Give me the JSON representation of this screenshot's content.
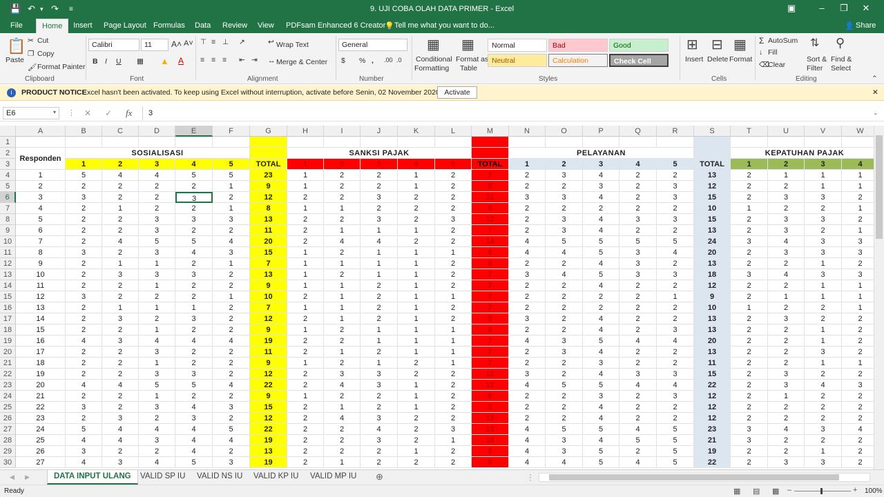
{
  "window": {
    "title": "9. UJI COBA OLAH DATA PRIMER - Excel",
    "share": "Share"
  },
  "tabs": [
    "File",
    "Home",
    "Insert",
    "Page Layout",
    "Formulas",
    "Data",
    "Review",
    "View",
    "PDFsam Enhanced 6 Creator",
    "Tell me what you want to do..."
  ],
  "ribbon": {
    "clipboard": {
      "paste": "Paste",
      "cut": "Cut",
      "copy": "Copy",
      "format_painter": "Format Painter",
      "group": "Clipboard"
    },
    "font": {
      "name": "Calibri",
      "size": "11",
      "group": "Font"
    },
    "alignment": {
      "wrap": "Wrap Text",
      "merge": "Merge & Center",
      "group": "Alignment"
    },
    "number": {
      "format": "General",
      "group": "Number"
    },
    "styles": {
      "conditional": "Conditional",
      "conditional2": "Formatting",
      "format_as": "Format as",
      "format_as2": "Table",
      "normal": "Normal",
      "bad": "Bad",
      "good": "Good",
      "neutral": "Neutral",
      "calculation": "Calculation",
      "check": "Check Cell",
      "group": "Styles"
    },
    "cells": {
      "insert": "Insert",
      "delete": "Delete",
      "format": "Format",
      "group": "Cells"
    },
    "editing": {
      "autosum": "AutoSum",
      "fill": "Fill",
      "clear": "Clear",
      "sort": "Sort &",
      "sort2": "Filter",
      "find": "Find &",
      "find2": "Select",
      "group": "Editing"
    }
  },
  "notice": {
    "label": "PRODUCT NOTICE",
    "text": "Excel hasn't been activated. To keep using Excel without interruption, activate before Senin, 02 November 2020.",
    "button": "Activate"
  },
  "formula_bar": {
    "name_box": "E6",
    "value": "3"
  },
  "grid": {
    "columns": [
      "A",
      "B",
      "C",
      "D",
      "E",
      "F",
      "G",
      "H",
      "I",
      "J",
      "K",
      "L",
      "M",
      "N",
      "O",
      "P",
      "Q",
      "R",
      "S",
      "T",
      "U",
      "V",
      "W"
    ],
    "row_numbers": [
      "1",
      "2",
      "3",
      "4",
      "5",
      "6",
      "7",
      "8",
      "9",
      "10",
      "11",
      "12",
      "13",
      "14",
      "15",
      "16",
      "17",
      "18",
      "19",
      "20",
      "21",
      "22",
      "23",
      "24",
      "25",
      "26",
      "27",
      "28",
      "29",
      "30"
    ],
    "responden_label": "Responden",
    "groups": [
      "SOSIALISASI",
      "SANKSI PAJAK",
      "PELAYANAN",
      "KEPATUHAN PAJAK"
    ],
    "subheaders": [
      "1",
      "2",
      "3",
      "4",
      "5",
      "TOTAL",
      "1",
      "2",
      "3",
      "4",
      "5",
      "TOTAL",
      "1",
      "2",
      "3",
      "4",
      "5",
      "TOTAL",
      "1",
      "2",
      "3",
      "4"
    ],
    "rows": [
      [
        "1",
        "5",
        "4",
        "4",
        "5",
        "5",
        "23",
        "1",
        "2",
        "2",
        "1",
        "2",
        "7",
        "2",
        "3",
        "4",
        "2",
        "2",
        "13",
        "2",
        "1",
        "1",
        "1"
      ],
      [
        "2",
        "2",
        "2",
        "2",
        "2",
        "1",
        "9",
        "1",
        "2",
        "2",
        "1",
        "2",
        "8",
        "2",
        "2",
        "3",
        "2",
        "3",
        "12",
        "2",
        "2",
        "1",
        "1"
      ],
      [
        "3",
        "3",
        "2",
        "2",
        "3",
        "2",
        "12",
        "2",
        "2",
        "3",
        "2",
        "2",
        "11",
        "3",
        "3",
        "4",
        "2",
        "3",
        "15",
        "2",
        "3",
        "3",
        "2"
      ],
      [
        "4",
        "2",
        "1",
        "2",
        "2",
        "1",
        "8",
        "1",
        "1",
        "2",
        "2",
        "2",
        "8",
        "2",
        "2",
        "2",
        "2",
        "2",
        "10",
        "1",
        "2",
        "2",
        "1"
      ],
      [
        "5",
        "2",
        "2",
        "3",
        "3",
        "3",
        "13",
        "2",
        "2",
        "3",
        "2",
        "3",
        "12",
        "2",
        "3",
        "4",
        "3",
        "3",
        "15",
        "2",
        "3",
        "3",
        "2"
      ],
      [
        "6",
        "2",
        "2",
        "3",
        "2",
        "2",
        "11",
        "2",
        "1",
        "1",
        "1",
        "2",
        "7",
        "2",
        "3",
        "4",
        "2",
        "2",
        "13",
        "2",
        "3",
        "2",
        "1"
      ],
      [
        "7",
        "2",
        "4",
        "5",
        "5",
        "4",
        "20",
        "2",
        "4",
        "4",
        "2",
        "2",
        "14",
        "4",
        "5",
        "5",
        "5",
        "5",
        "24",
        "3",
        "4",
        "3",
        "3"
      ],
      [
        "8",
        "3",
        "2",
        "3",
        "4",
        "3",
        "15",
        "1",
        "2",
        "1",
        "1",
        "1",
        "6",
        "4",
        "4",
        "5",
        "3",
        "4",
        "20",
        "2",
        "3",
        "3",
        "3"
      ],
      [
        "9",
        "2",
        "1",
        "1",
        "2",
        "1",
        "7",
        "1",
        "1",
        "1",
        "1",
        "2",
        "6",
        "2",
        "2",
        "4",
        "3",
        "2",
        "13",
        "2",
        "2",
        "1",
        "2"
      ],
      [
        "10",
        "2",
        "3",
        "3",
        "3",
        "2",
        "13",
        "1",
        "2",
        "1",
        "1",
        "2",
        "7",
        "3",
        "4",
        "5",
        "3",
        "3",
        "18",
        "3",
        "4",
        "3",
        "3"
      ],
      [
        "11",
        "2",
        "2",
        "1",
        "2",
        "2",
        "9",
        "1",
        "1",
        "2",
        "1",
        "2",
        "7",
        "2",
        "2",
        "4",
        "2",
        "2",
        "12",
        "2",
        "2",
        "1",
        "1"
      ],
      [
        "12",
        "3",
        "2",
        "2",
        "2",
        "1",
        "10",
        "2",
        "1",
        "2",
        "1",
        "1",
        "7",
        "2",
        "2",
        "2",
        "2",
        "1",
        "9",
        "2",
        "1",
        "1",
        "1"
      ],
      [
        "13",
        "2",
        "1",
        "1",
        "1",
        "2",
        "7",
        "1",
        "1",
        "2",
        "1",
        "2",
        "7",
        "2",
        "2",
        "2",
        "2",
        "2",
        "10",
        "1",
        "2",
        "2",
        "1"
      ],
      [
        "14",
        "2",
        "3",
        "2",
        "3",
        "2",
        "12",
        "2",
        "1",
        "2",
        "1",
        "2",
        "8",
        "3",
        "2",
        "4",
        "2",
        "2",
        "13",
        "2",
        "3",
        "2",
        "2"
      ],
      [
        "15",
        "2",
        "2",
        "1",
        "2",
        "2",
        "9",
        "1",
        "2",
        "1",
        "1",
        "1",
        "6",
        "2",
        "2",
        "4",
        "2",
        "3",
        "13",
        "2",
        "2",
        "1",
        "2"
      ],
      [
        "16",
        "4",
        "3",
        "4",
        "4",
        "4",
        "19",
        "2",
        "2",
        "1",
        "1",
        "1",
        "7",
        "4",
        "3",
        "5",
        "4",
        "4",
        "20",
        "2",
        "2",
        "1",
        "2"
      ],
      [
        "17",
        "2",
        "2",
        "3",
        "2",
        "2",
        "11",
        "2",
        "1",
        "2",
        "1",
        "1",
        "7",
        "2",
        "3",
        "4",
        "2",
        "2",
        "13",
        "2",
        "2",
        "3",
        "2"
      ],
      [
        "18",
        "2",
        "2",
        "1",
        "2",
        "2",
        "9",
        "1",
        "2",
        "1",
        "2",
        "1",
        "7",
        "2",
        "2",
        "3",
        "2",
        "2",
        "11",
        "2",
        "2",
        "1",
        "1"
      ],
      [
        "19",
        "2",
        "2",
        "3",
        "3",
        "2",
        "12",
        "2",
        "3",
        "3",
        "2",
        "2",
        "12",
        "3",
        "2",
        "4",
        "3",
        "3",
        "15",
        "2",
        "3",
        "2",
        "2"
      ],
      [
        "20",
        "4",
        "4",
        "5",
        "5",
        "4",
        "22",
        "2",
        "4",
        "3",
        "1",
        "2",
        "12",
        "4",
        "5",
        "5",
        "4",
        "4",
        "22",
        "2",
        "3",
        "4",
        "3"
      ],
      [
        "21",
        "2",
        "2",
        "1",
        "2",
        "2",
        "9",
        "1",
        "2",
        "2",
        "1",
        "2",
        "8",
        "2",
        "2",
        "3",
        "2",
        "3",
        "12",
        "2",
        "1",
        "2",
        "2"
      ],
      [
        "22",
        "3",
        "2",
        "3",
        "4",
        "3",
        "15",
        "2",
        "1",
        "2",
        "1",
        "2",
        "8",
        "2",
        "2",
        "4",
        "2",
        "2",
        "12",
        "2",
        "2",
        "2",
        "2"
      ],
      [
        "23",
        "2",
        "3",
        "2",
        "3",
        "2",
        "12",
        "2",
        "4",
        "3",
        "2",
        "2",
        "13",
        "2",
        "2",
        "4",
        "2",
        "2",
        "12",
        "2",
        "2",
        "2",
        "2"
      ],
      [
        "24",
        "5",
        "4",
        "4",
        "4",
        "5",
        "22",
        "2",
        "2",
        "4",
        "2",
        "3",
        "13",
        "4",
        "5",
        "5",
        "4",
        "5",
        "23",
        "3",
        "4",
        "3",
        "4"
      ],
      [
        "25",
        "4",
        "4",
        "3",
        "4",
        "4",
        "19",
        "2",
        "2",
        "3",
        "2",
        "1",
        "10",
        "4",
        "3",
        "4",
        "5",
        "5",
        "21",
        "3",
        "2",
        "2",
        "2"
      ],
      [
        "26",
        "3",
        "2",
        "2",
        "4",
        "2",
        "13",
        "2",
        "2",
        "2",
        "1",
        "2",
        "9",
        "4",
        "3",
        "5",
        "2",
        "5",
        "19",
        "2",
        "2",
        "1",
        "2"
      ],
      [
        "27",
        "4",
        "3",
        "4",
        "5",
        "3",
        "19",
        "2",
        "1",
        "2",
        "2",
        "2",
        "9",
        "4",
        "4",
        "5",
        "4",
        "5",
        "22",
        "2",
        "3",
        "3",
        "2"
      ]
    ]
  },
  "sheets": [
    "DATA INPUT ULANG",
    "VALID SP IU",
    "VALID NS IU",
    "VALID KP IU",
    "VALID MP IU"
  ],
  "status": {
    "ready": "Ready",
    "zoom": "100%"
  },
  "colors": {
    "excel_green": "#217346",
    "yellow": "#ffff00",
    "red": "#ff0000",
    "light_blue": "#dce6f0",
    "olive": "#9bbb59"
  }
}
